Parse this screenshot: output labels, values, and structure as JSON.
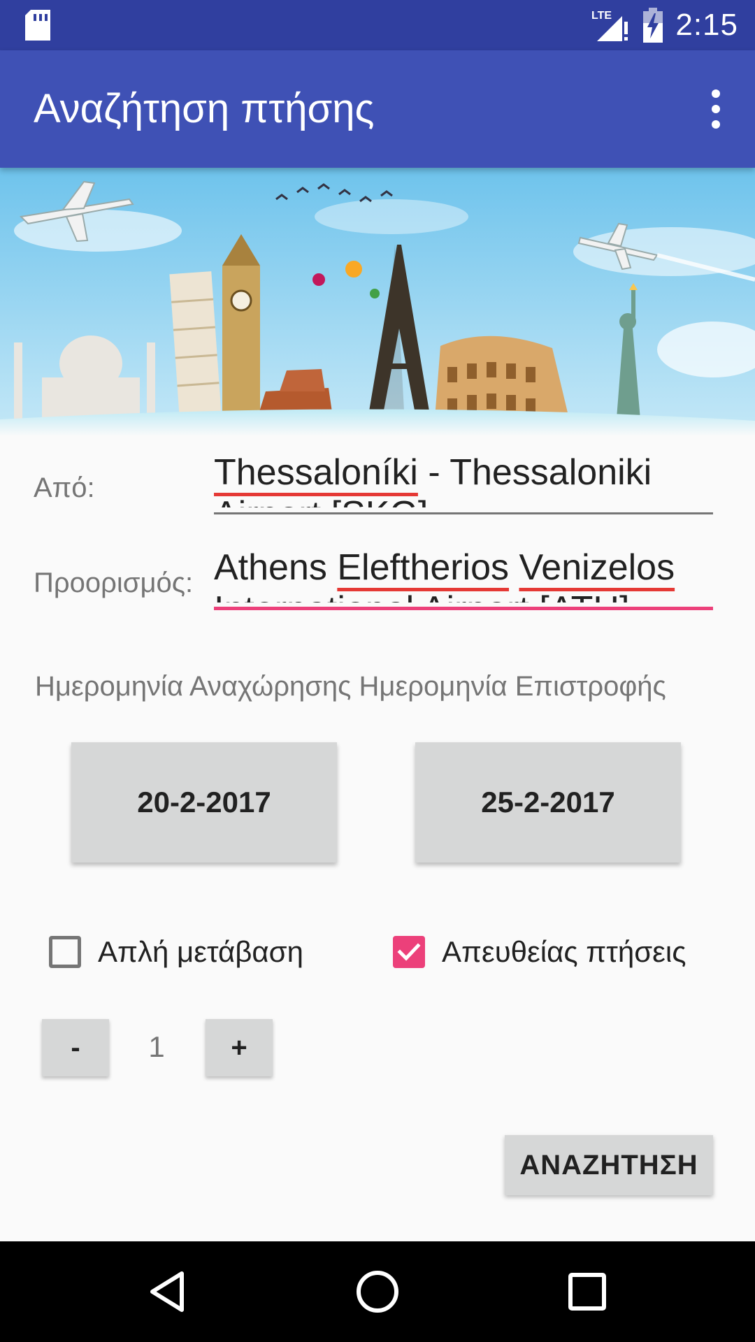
{
  "status_bar": {
    "time": "2:15",
    "network": "LTE"
  },
  "app_bar": {
    "title": "Αναζήτηση πτήσης",
    "menu_icon": "more-vert-icon"
  },
  "hero": {
    "image": "travel-landmarks-banner"
  },
  "form": {
    "from_label": "Από:",
    "from_value_parts": [
      "Thessaloníki",
      " - Thessaloniki"
    ],
    "from_value_overflow": "Airport [SKG]",
    "to_label": "Προορισμός:",
    "to_value_parts": [
      "Athens ",
      "Eleftherios",
      " ",
      "Venizelos"
    ],
    "to_value_overflow": "International Airport [ATH]"
  },
  "dates": {
    "header": "Ημερομηνία Αναχώρησης Ημερομηνία Επιστροφής",
    "departure": "20-2-2017",
    "return": "25-2-2017"
  },
  "options": {
    "one_way_label": "Απλή μετάβαση",
    "one_way_checked": false,
    "direct_label": "Απευθείας πτήσεις",
    "direct_checked": true
  },
  "passengers": {
    "minus": "-",
    "value": "1",
    "plus": "+"
  },
  "search_button": "ΑΝΑΖΗΤΗΣΗ",
  "colors": {
    "primary": "#3f51b5",
    "primary_dark": "#303f9f",
    "accent": "#ec407a"
  }
}
